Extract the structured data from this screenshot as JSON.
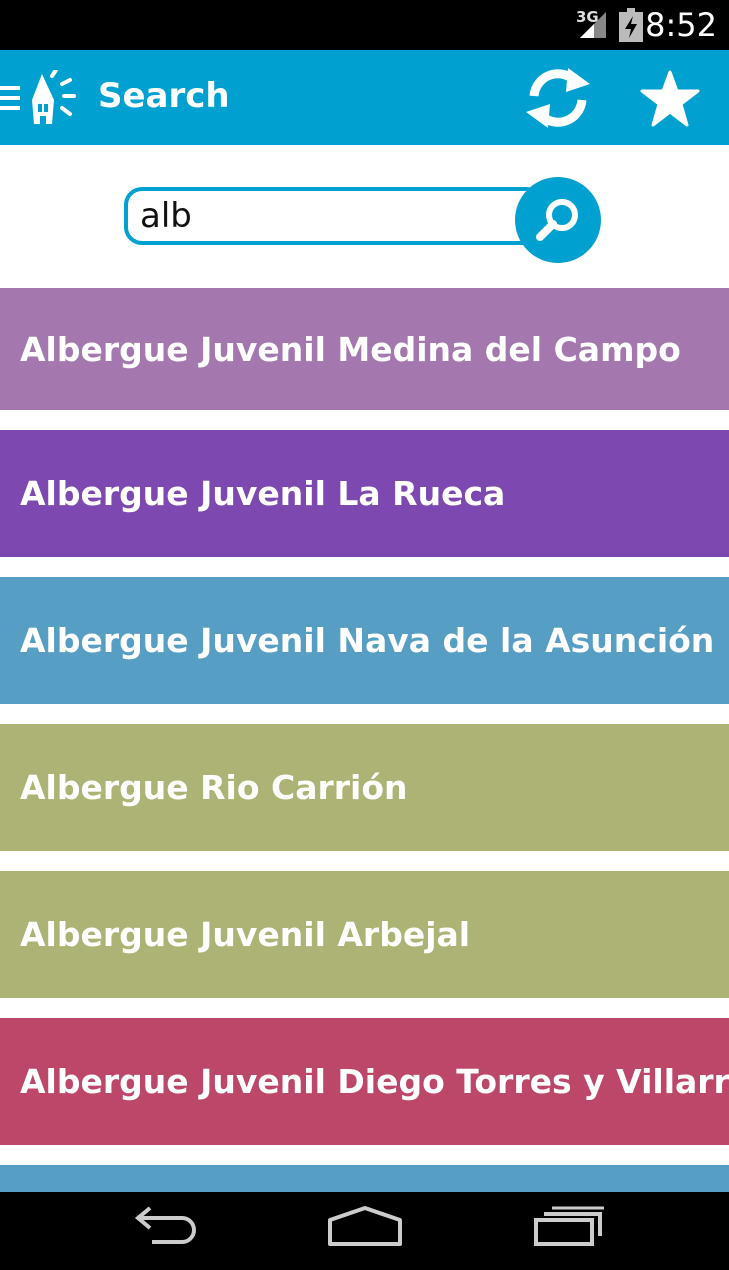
{
  "status_bar": {
    "network": "3G",
    "time": "8:52"
  },
  "action_bar": {
    "title": "Search",
    "icons": [
      "menu-icon",
      "hostel-logo-icon",
      "sync-icon",
      "star-icon"
    ]
  },
  "search": {
    "value": "alb",
    "placeholder": ""
  },
  "results": [
    {
      "label": "Albergue Juvenil Medina del Campo",
      "color": "#a477ae"
    },
    {
      "label": "Albergue Juvenil La Rueca",
      "color": "#7d49b0"
    },
    {
      "label": "Albergue Juvenil Nava de la Asunción",
      "color": "#569ec3"
    },
    {
      "label": "Albergue Rio Carrión",
      "color": "#adb374"
    },
    {
      "label": "Albergue Juvenil Arbejal",
      "color": "#adb374"
    },
    {
      "label": "Albergue Juvenil Diego Torres y Villarroel",
      "color": "#bd4768"
    },
    {
      "label": "",
      "color": "#569ec3"
    }
  ],
  "colors": {
    "accent": "#00a1d0"
  },
  "nav_bar": {
    "icons": [
      "back-icon",
      "home-icon",
      "recent-apps-icon"
    ]
  }
}
